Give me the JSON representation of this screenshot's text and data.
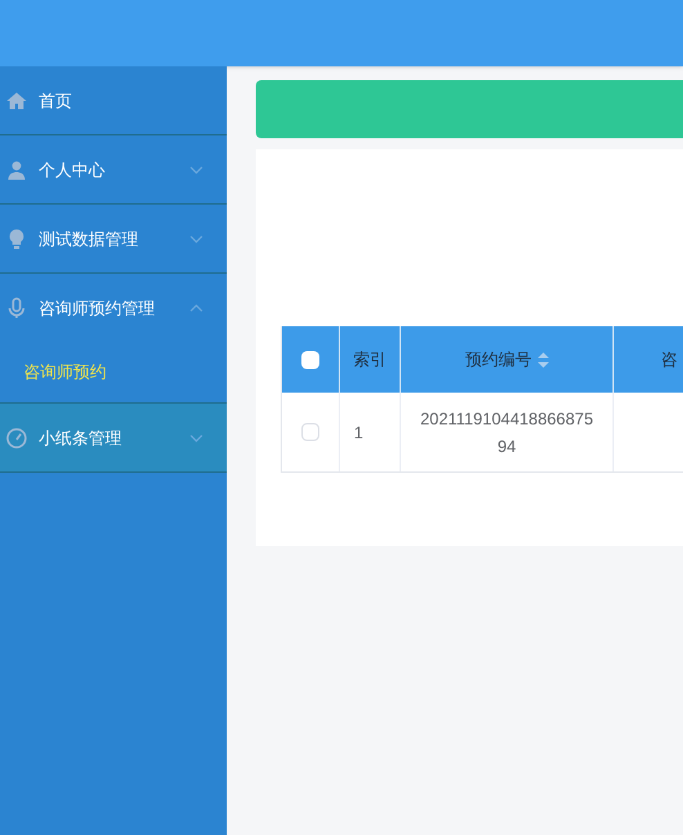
{
  "sidebar": {
    "items": [
      {
        "label": "首页",
        "highlighted": false
      },
      {
        "label": "个人中心",
        "expanded": false,
        "highlighted": false
      },
      {
        "label": "测试数据管理",
        "expanded": false,
        "highlighted": false
      },
      {
        "label": "咨询师预约管理",
        "expanded": true,
        "highlighted": false,
        "children": [
          {
            "label": "咨询师预约",
            "selected": true
          }
        ]
      },
      {
        "label": "小纸条管理",
        "expanded": false,
        "highlighted": true
      }
    ]
  },
  "table": {
    "header_checked": false,
    "columns": [
      {
        "label": "索引",
        "sortable": false
      },
      {
        "label": "预约编号",
        "sortable": true
      },
      {
        "label": "咨"
      }
    ],
    "rows": [
      {
        "checked": false,
        "cells": [
          "1",
          "202111910441886687594",
          ""
        ]
      }
    ]
  }
}
